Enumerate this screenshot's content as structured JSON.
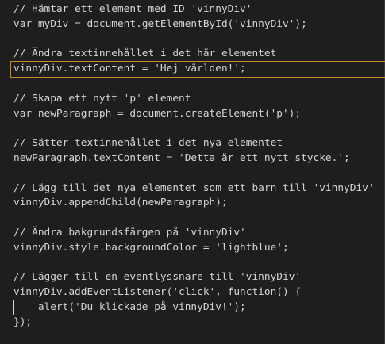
{
  "editor": {
    "lines": [
      "// Hämtar ett element med ID 'vinnyDiv'",
      "var myDiv = document.getElementById('vinnyDiv');",
      "",
      "// Ändra textinnehållet i det här elementet",
      "vinnyDiv.textContent = 'Hej världen!';",
      "",
      "// Skapa ett nytt 'p' element",
      "var newParagraph = document.createElement('p');",
      "",
      "// Sätter textinnehållet i det nya elementet",
      "newParagraph.textContent = 'Detta är ett nytt stycke.';",
      "",
      "// Lägg till det nya elementet som ett barn till 'vinnyDiv'",
      "vinnyDiv.appendChild(newParagraph);",
      "",
      "// Ändra bakgrundsfärgen på 'vinnyDiv'",
      "vinnyDiv.style.backgroundColor = 'lightblue';",
      "",
      "// Lägger till en eventlyssnare till 'vinnyDiv'",
      "vinnyDiv.addEventListener('click', function() {",
      "    alert('Du klickade på vinnyDiv!');",
      "});"
    ],
    "current_line": 5
  },
  "colors": {
    "background": "#1e1e1e",
    "text": "#d4d4d4",
    "current_line_border": "#c98a2b"
  }
}
